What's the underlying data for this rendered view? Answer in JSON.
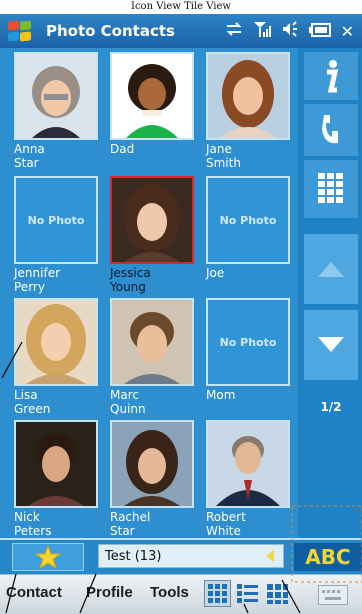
{
  "caption": "Icon View  Tile View",
  "app": {
    "title": "Photo Contacts",
    "colors": {
      "titlebar": "#1f6db1",
      "grid_bg": "#2d8fd0",
      "accent_yellow": "#f7d431",
      "selected_border": "#d8262c"
    }
  },
  "status": {
    "sync_icon": "sync-arrows-icon",
    "signal_icon": "signal-icon",
    "volume_icon": "speaker-icon",
    "battery_icon": "battery-icon",
    "close_label": "✕"
  },
  "contacts": [
    {
      "first": "Anna",
      "last": "Star",
      "photo": "woman-gray-hair"
    },
    {
      "first": "Dad",
      "last": "",
      "photo": "cartoon-afro"
    },
    {
      "first": "Jane",
      "last": "Smith",
      "photo": "woman-auburn"
    },
    {
      "first": "Jennifer",
      "last": "Perry",
      "photo": "none"
    },
    {
      "first": "Jessica",
      "last": "Young",
      "photo": "woman-brunette"
    },
    {
      "first": "Joe",
      "last": "",
      "photo": "none"
    },
    {
      "first": "Lisa",
      "last": "Green",
      "photo": "woman-blonde"
    },
    {
      "first": "Marc",
      "last": "Quinn",
      "photo": "man-brown-hair"
    },
    {
      "first": "Mom",
      "last": "",
      "photo": "none"
    },
    {
      "first": "Nick",
      "last": "Peters",
      "photo": "man-dark-hair"
    },
    {
      "first": "Rachel",
      "last": "Star",
      "photo": "woman-dark-hair"
    },
    {
      "first": "Robert",
      "last": "White",
      "photo": "man-suit"
    }
  ],
  "no_photo_label": "No Photo",
  "selected_contact": "Jessica Young",
  "sidebar": {
    "info_icon": "info-icon",
    "call_icon": "phone-icon",
    "dialpad_icon": "dialpad-icon",
    "up_icon": "arrow-up-icon",
    "down_icon": "arrow-down-icon",
    "page": "1/2"
  },
  "bottombar": {
    "favorites_icon": "star-icon",
    "group": "Test (13)",
    "group_arrow_icon": "triangle-left-icon",
    "abc_label": "ABC"
  },
  "menu": {
    "contact": "Contact",
    "profile": "Profile",
    "tools": "Tools",
    "icon_view_icon": "icon-view-icon",
    "list_view_icon": "list-view-icon",
    "tile_view_icon": "tile-view-icon",
    "keyboard_icon": "keyboard-icon"
  }
}
